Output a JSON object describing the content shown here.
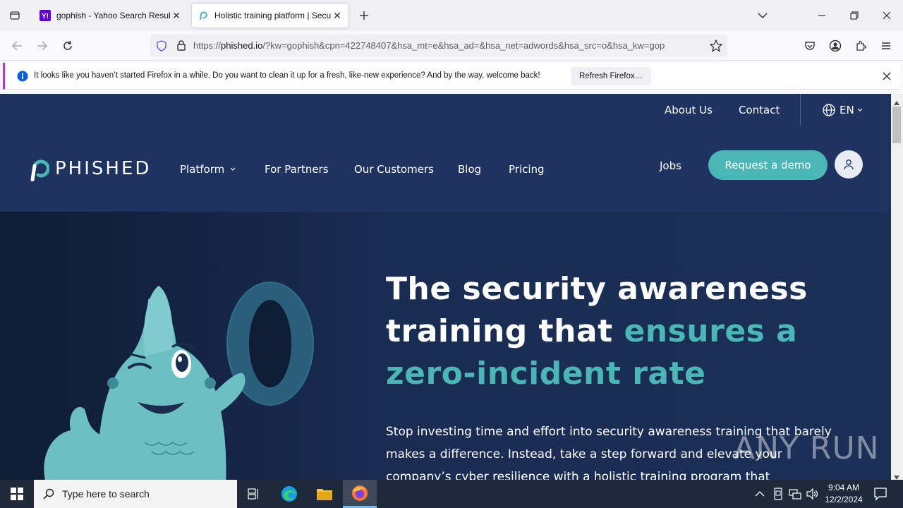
{
  "browser": {
    "tabs": [
      {
        "title": "gophish - Yahoo Search Results",
        "favicon": "yahoo-icon",
        "active": false
      },
      {
        "title": "Holistic training platform | Secu",
        "favicon": "phished-icon",
        "active": true
      }
    ],
    "url_prefix": "https://",
    "url_domain": "phished.io",
    "url_rest": "/?kw=gophish&cpn=422748407&hsa_mt=e&hsa_ad=&hsa_net=adwords&hsa_src=o&hsa_kw=gop",
    "notification": {
      "text": "It looks like you haven’t started Firefox in a while. Do you want to clean it up for a fresh, like-new experience? And by the way, welcome back!",
      "button": "Refresh Firefox…"
    }
  },
  "site": {
    "top_links": [
      "About Us",
      "Contact"
    ],
    "language": "EN",
    "logo": "PHISHED",
    "nav": [
      "Platform",
      "For Partners",
      "Our Customers",
      "Blog",
      "Pricing"
    ],
    "jobs": "Jobs",
    "cta": "Request a demo",
    "hero": {
      "title_part1": "The security awareness training that ",
      "title_accent": "ensures a zero-incident rate",
      "subtitle": "Stop investing time and effort into security awareness training that barely makes a difference. Instead, take a step forward and elevate your company’s cyber resilience with a holistic training program that"
    },
    "mascot_number": "0"
  },
  "taskbar": {
    "search_placeholder": "Type here to search",
    "time": "9:04 AM",
    "date": "12/2/2024"
  },
  "watermark": "ANY RUN",
  "colors": {
    "accent": "#4ab6b5",
    "header_bg": "#1e3360",
    "hero_bg": "#162a4e"
  }
}
